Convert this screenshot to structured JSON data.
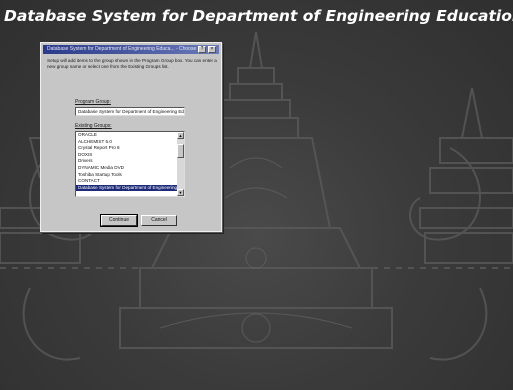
{
  "window": {
    "title": "Database System for Department of Engineering Education Setup"
  },
  "dialog": {
    "title": "Database System for Department of Engineering Educa... - Choose Pr...",
    "help_label": "?",
    "close_label": "×",
    "description": "Setup will add items to the group shown in the Program Group box. You can enter a new group name or select one from the Existing Groups list.",
    "program_group_label": "Program Group:",
    "program_group_value": "Database System for Department of Engineering Education Setup",
    "existing_groups_label": "Existing Groups:",
    "existing_groups": [
      "ORACLE",
      "ALCHEMIST 5.0",
      "Crystal Report Pro 8",
      "DOXIS",
      "Drivers",
      "DYNAMIC Media DVD",
      "Toshiba Startup Tools",
      "CONTACT",
      "Database System for Department of Engineering Education"
    ],
    "selected_index": 8,
    "scroll_up": "▲",
    "scroll_down": "▼",
    "continue_label": "Continue",
    "cancel_label": "Cancel"
  },
  "colors": {
    "background": "#3a3a3a",
    "dialog_face": "#c6c6c6",
    "title_bar": "#2a3a8a",
    "selection": "#1c2a78"
  }
}
